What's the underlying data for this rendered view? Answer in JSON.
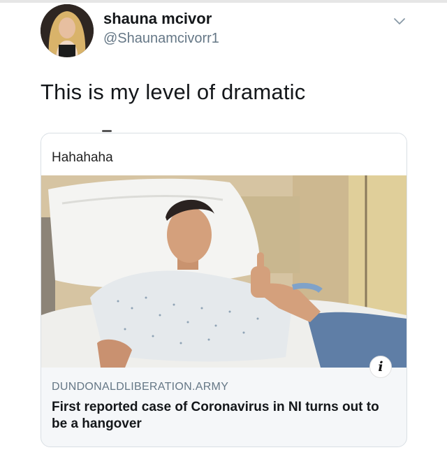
{
  "tweet": {
    "display_name": "shauna mcivor",
    "handle": "@Shaunamcivorr1",
    "text": "This is my level of dramatic",
    "menu_icon": "chevron-down-icon",
    "avatar_icon": "profile-photo"
  },
  "card": {
    "header_text": "Hahahaha",
    "image": "hospital-bed-photo",
    "info_icon": "info-icon",
    "info_glyph": "i",
    "domain": "DUNDONALDLIBERATION.ARMY",
    "title": "First reported case of Coronavirus in NI turns out to be a hangover"
  },
  "colors": {
    "text_primary": "#14171a",
    "text_secondary": "#657786",
    "card_border": "#d9dfe4",
    "card_footer_bg": "#f5f7f9"
  }
}
